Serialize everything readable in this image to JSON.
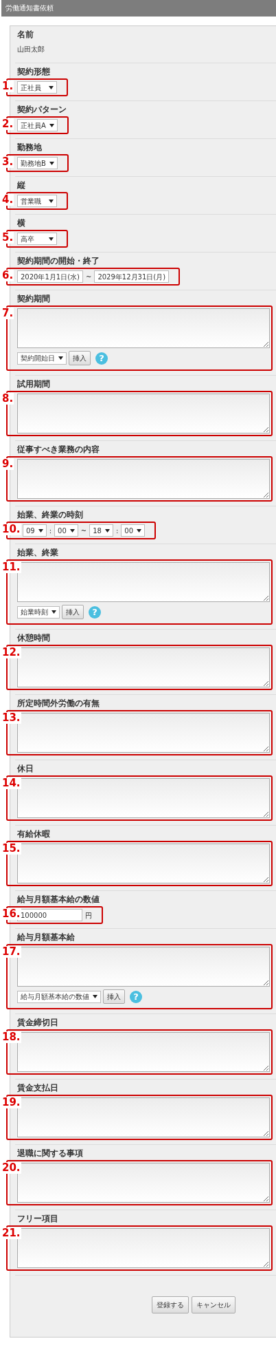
{
  "title": "労働通知書依頼",
  "fields": [
    {
      "kind": "text",
      "label": "名前",
      "value": "山田太郎"
    },
    {
      "kind": "select",
      "label": "契約形態",
      "number": "1.",
      "value": "正社員"
    },
    {
      "kind": "select",
      "label": "契約パターン",
      "number": "2.",
      "value": "正社員A"
    },
    {
      "kind": "select",
      "label": "勤務地",
      "number": "3.",
      "value": "勤務地B"
    },
    {
      "kind": "select",
      "label": "縦",
      "number": "4.",
      "value": "営業職"
    },
    {
      "kind": "select",
      "label": "横",
      "number": "5.",
      "value": "高卒"
    },
    {
      "kind": "daterange",
      "label": "契約期間の開始・終了",
      "number": "6.",
      "start": "2020年1月1日(水)",
      "separator": "~",
      "end": "2029年12月31日(月)"
    },
    {
      "kind": "textarea_insert",
      "label": "契約期間",
      "number": "7.",
      "insert_select": "契約開始日",
      "insert_button": "挿入",
      "help": "?"
    },
    {
      "kind": "textarea",
      "label": "試用期間",
      "number": "8."
    },
    {
      "kind": "textarea",
      "label": "従事すべき業務の内容",
      "number": "9."
    },
    {
      "kind": "time",
      "label": "始業、終業の時刻",
      "number": "10.",
      "parts": [
        {
          "kind": "select",
          "text": "09"
        },
        {
          "kind": "sep",
          "text": ":"
        },
        {
          "kind": "select",
          "text": "00"
        },
        {
          "kind": "sep",
          "text": "~"
        },
        {
          "kind": "select",
          "text": "18"
        },
        {
          "kind": "sep",
          "text": ":"
        },
        {
          "kind": "select",
          "text": "00"
        }
      ]
    },
    {
      "kind": "textarea_insert",
      "label": "始業、終業",
      "number": "11.",
      "insert_select": "始業時刻",
      "insert_button": "挿入",
      "help": "?"
    },
    {
      "kind": "textarea",
      "label": "休憩時間",
      "number": "12."
    },
    {
      "kind": "textarea",
      "label": "所定時間外労働の有無",
      "number": "13."
    },
    {
      "kind": "textarea",
      "label": "休日",
      "number": "14."
    },
    {
      "kind": "textarea",
      "label": "有給休暇",
      "number": "15."
    },
    {
      "kind": "number",
      "label": "給与月額基本給の数値",
      "number": "16.",
      "value": "100000",
      "unit": "円"
    },
    {
      "kind": "textarea_insert",
      "label": "給与月額基本給",
      "number": "17.",
      "insert_select": "給与月額基本給の数値",
      "insert_button": "挿入",
      "help": "?"
    },
    {
      "kind": "textarea",
      "label": "賃金締切日",
      "number": "18."
    },
    {
      "kind": "textarea",
      "label": "賃金支払日",
      "number": "19."
    },
    {
      "kind": "textarea",
      "label": "退職に関する事項",
      "number": "20."
    },
    {
      "kind": "textarea",
      "label": "フリー項目",
      "number": "21."
    }
  ],
  "buttons": [
    {
      "label": "登録する"
    },
    {
      "label": "キャンセル"
    }
  ]
}
